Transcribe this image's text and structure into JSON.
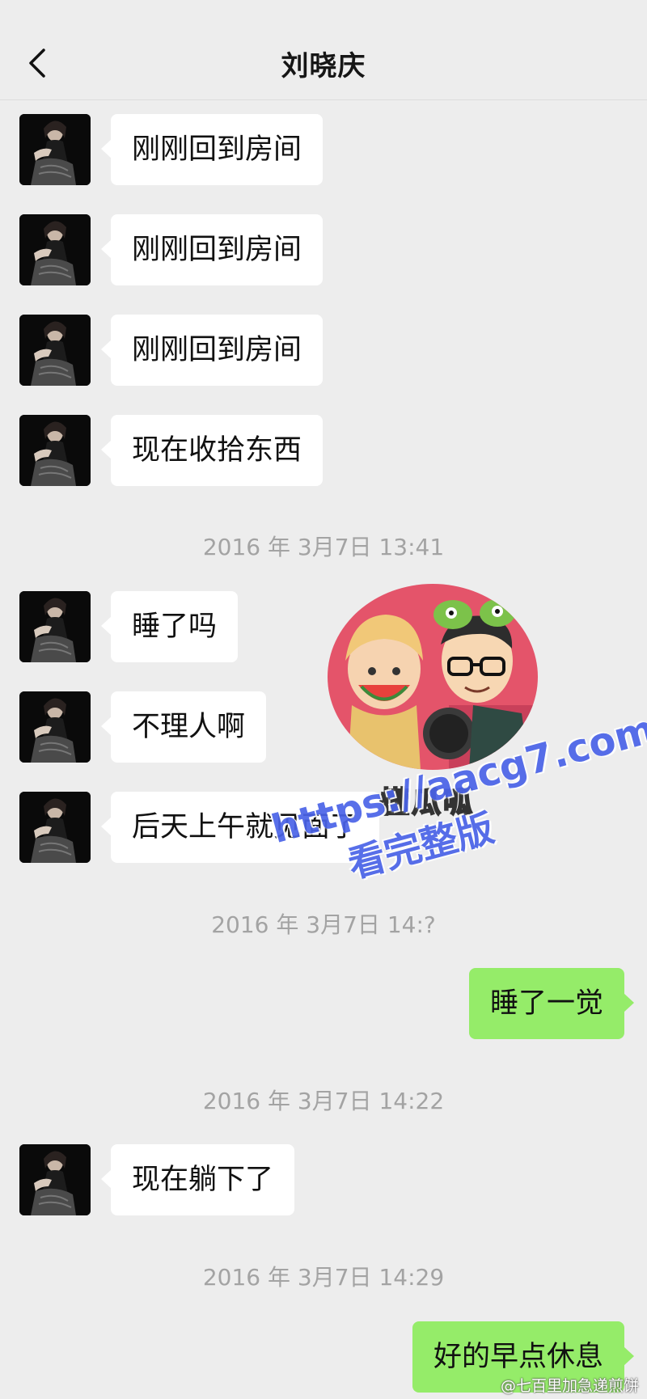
{
  "header": {
    "title": "刘晓庆",
    "back_icon": "chevron-left-icon"
  },
  "messages": [
    {
      "type": "in",
      "text": "刚刚回到房间"
    },
    {
      "type": "in",
      "text": "刚刚回到房间"
    },
    {
      "type": "in",
      "text": "刚刚回到房间"
    },
    {
      "type": "in",
      "text": "现在收拾东西"
    },
    {
      "type": "timestamp",
      "text": "2016 年 3月7日 13:41"
    },
    {
      "type": "in",
      "text": "睡了吗"
    },
    {
      "type": "in",
      "text": "不理人啊"
    },
    {
      "type": "in",
      "text": "后天上午就见面了"
    },
    {
      "type": "timestamp",
      "text": "2016 年 3月7日 14:?"
    },
    {
      "type": "out",
      "text": "睡了一觉"
    },
    {
      "type": "timestamp",
      "text": "2016 年 3月7日 14:22"
    },
    {
      "type": "in",
      "text": "现在躺下了"
    },
    {
      "type": "timestamp",
      "text": "2016 年 3月7日 14:29"
    },
    {
      "type": "out",
      "text": "好的早点休息"
    }
  ],
  "overlay": {
    "sticker_label": "懂瓜呱",
    "watermark_url": "https://aacg7.com",
    "watermark_cta": "看完整版",
    "credit": "@七百里加急递煎饼"
  },
  "colors": {
    "incoming_bubble": "#ffffff",
    "outgoing_bubble": "#95ec69",
    "background": "#ededed"
  }
}
